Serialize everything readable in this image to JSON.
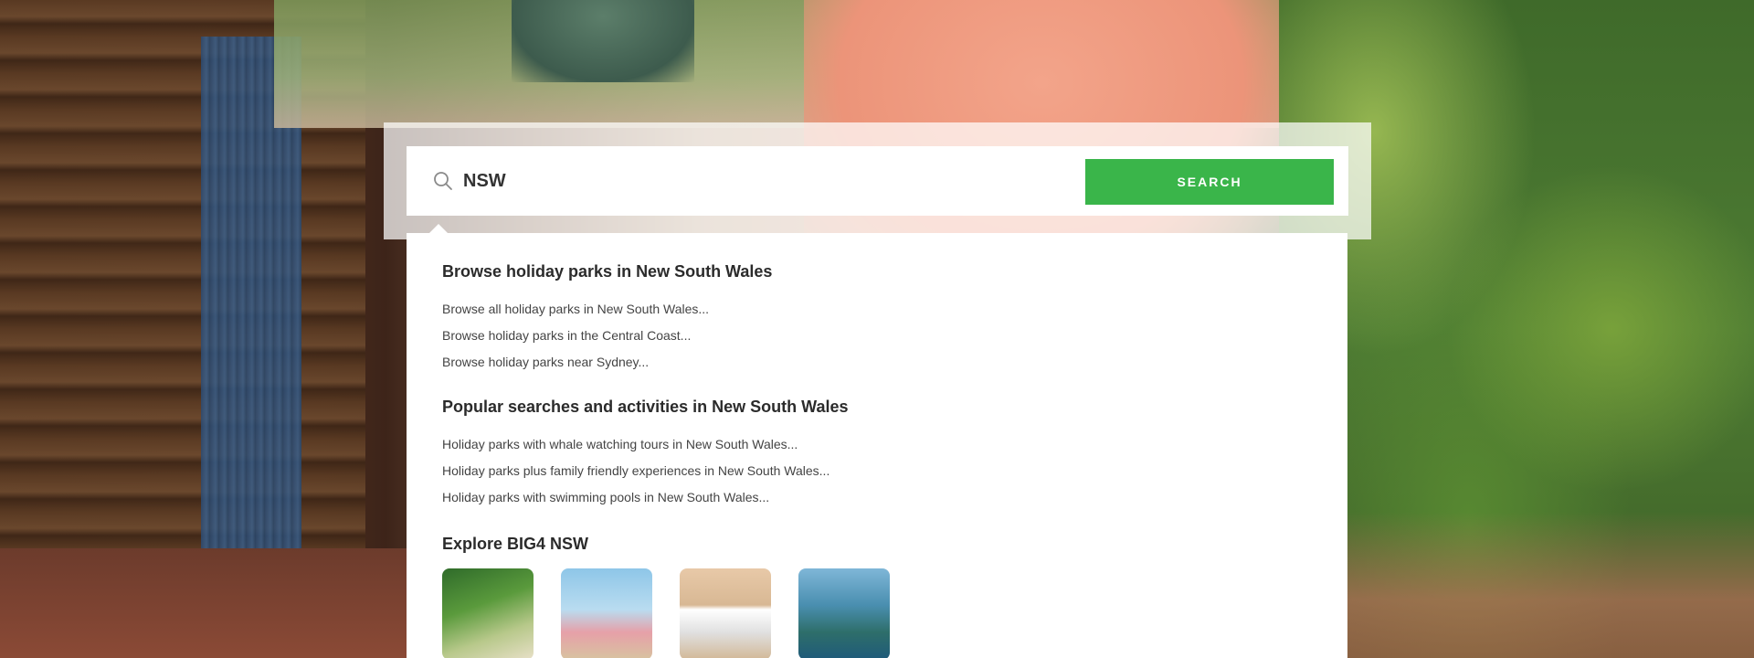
{
  "search": {
    "value": "NSW",
    "button_label": "SEARCH"
  },
  "dropdown": {
    "browse": {
      "heading": "Browse holiday parks in New South Wales",
      "items": [
        "Browse all holiday parks in New South Wales...",
        "Browse holiday parks in the Central Coast...",
        "Browse holiday parks near Sydney..."
      ]
    },
    "popular": {
      "heading": "Popular searches and activities in New South Wales",
      "items": [
        "Holiday parks with whale watching tours in New South Wales...",
        "Holiday parks plus family friendly experiences in New South Wales...",
        "Holiday parks with swimming pools in New South Wales..."
      ]
    },
    "explore": {
      "heading": "Explore BIG4 NSW"
    }
  },
  "colors": {
    "accent": "#3ab54a",
    "heading_text": "#2b2b2b",
    "body_text": "#444444"
  }
}
